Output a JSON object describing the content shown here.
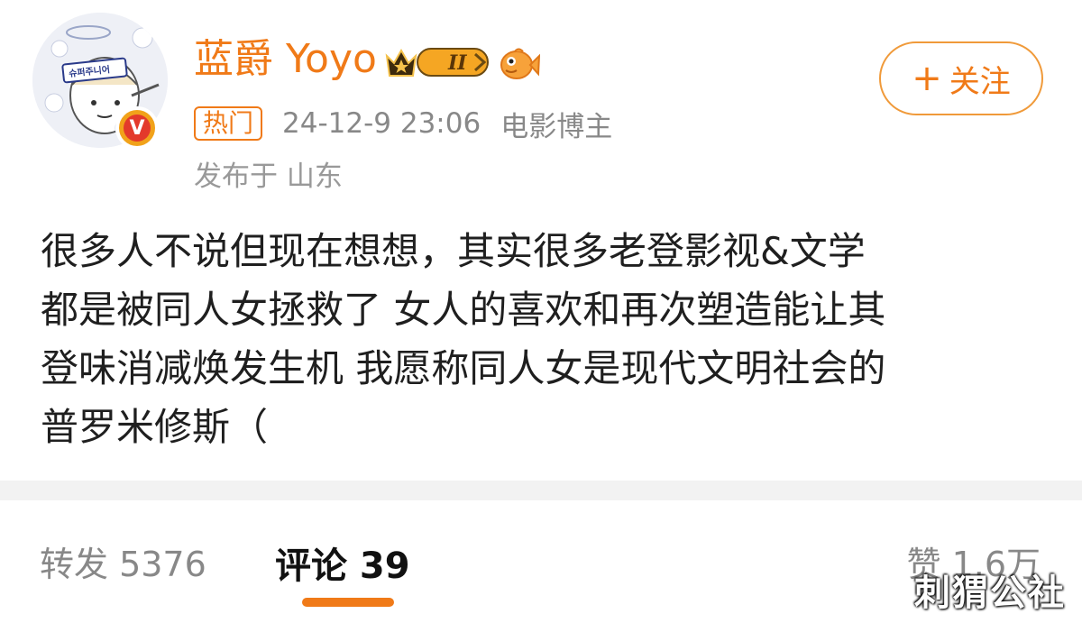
{
  "post": {
    "author": {
      "name": "蓝爵 Yoyo",
      "avatar_sign": "슈퍼주니어",
      "verified_mark": "V",
      "level_badge": "II"
    },
    "follow_button": {
      "icon": "+",
      "label": "关注"
    },
    "meta": {
      "hot_tag": "热门",
      "time": "24-12-9 23:06",
      "role": "电影博主",
      "location": "发布于 山东"
    },
    "text_lines": [
      "很多人不说但现在想想，其实很多老登影视&文学",
      "都是被同人女拯救了 女人的喜欢和再次塑造能让其",
      "登味消减焕发生机 我愿称同人女是现代文明社会的",
      "普罗米修斯（"
    ]
  },
  "tabs": {
    "repost": "转发 5376",
    "comment": "评论 39",
    "like": "赞 1.6万"
  },
  "watermark": "刺猬公社",
  "colors": {
    "accent": "#f07a18",
    "muted": "#888888",
    "divider": "#f2f2f2"
  }
}
